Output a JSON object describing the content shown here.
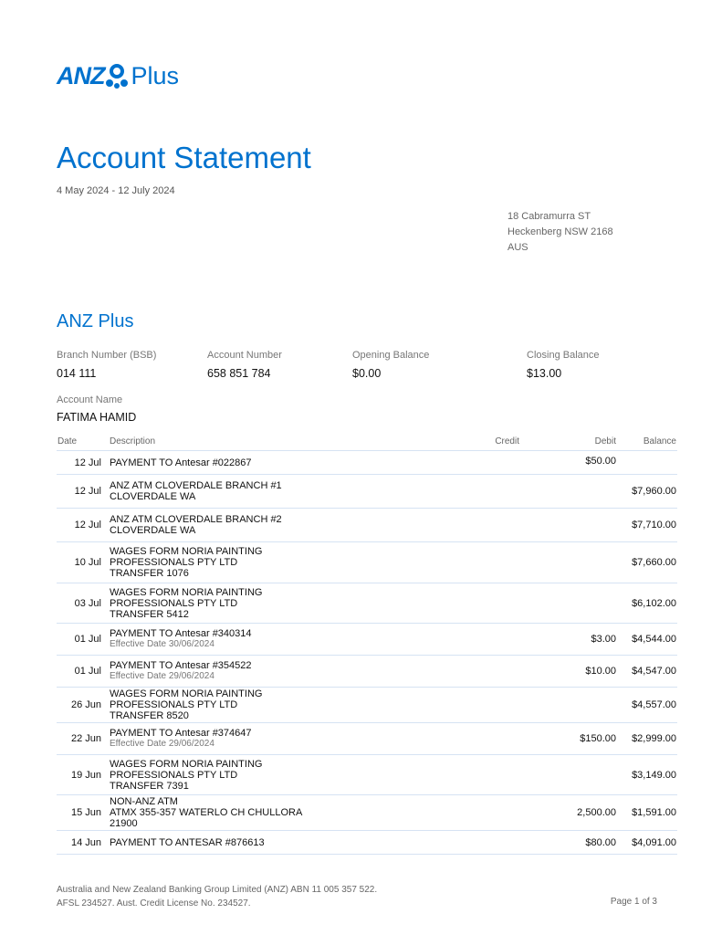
{
  "brand": {
    "logo_anz": "ANZ",
    "logo_plus": "Plus"
  },
  "title": "Account Statement",
  "period": "4 May 2024 - 12 July 2024",
  "address": [
    "18 Cabramurra ST",
    "Heckenberg NSW 2168",
    "AUS"
  ],
  "product": "ANZ Plus",
  "details": {
    "bsb_label": "Branch Number (BSB)",
    "bsb": "014 111",
    "acct_label": "Account Number",
    "acct": "658 851 784",
    "open_label": "Opening Balance",
    "open": "$0.00",
    "close_label": "Closing Balance",
    "close": "$13.00",
    "name_label": "Account Name",
    "name": "FATIMA HAMID"
  },
  "columns": {
    "date": "Date",
    "description": "Description",
    "credit": "Credit",
    "debit": "Debit",
    "balance": "Balance"
  },
  "transactions": [
    {
      "date": "12 Jul",
      "desc": [
        "PAYMENT TO Antesar #022867"
      ],
      "sub": "",
      "credit": "",
      "debit": "$50.00",
      "balance": ""
    },
    {
      "date": "12 Jul",
      "desc": [
        "ANZ ATM CLOVERDALE BRANCH #1",
        "CLOVERDALE WA"
      ],
      "sub": "",
      "credit": "",
      "debit": "",
      "balance": "$7,960.00"
    },
    {
      "date": "12 Jul",
      "desc": [
        "ANZ ATM CLOVERDALE BRANCH #2",
        "CLOVERDALE WA"
      ],
      "sub": "",
      "credit": "",
      "debit": "",
      "balance": "$7,710.00"
    },
    {
      "date": "10 Jul",
      "desc": [
        "WAGES FORM NORIA PAINTING",
        "PROFESSIONALS PTY LTD",
        "TRANSFER 1076"
      ],
      "sub": "",
      "credit": "",
      "debit": "",
      "balance": "$7,660.00"
    },
    {
      "date": "03 Jul",
      "desc": [
        "WAGES FORM NORIA PAINTING",
        "PROFESSIONALS PTY LTD",
        "TRANSFER 5412"
      ],
      "sub": "",
      "credit": "",
      "debit": "",
      "balance": "$6,102.00"
    },
    {
      "date": "01 Jul",
      "desc": [
        "PAYMENT TO Antesar #340314"
      ],
      "sub": "Effective Date 30/06/2024",
      "credit": "",
      "debit": "$3.00",
      "balance": "$4,544.00"
    },
    {
      "date": "01 Jul",
      "desc": [
        "PAYMENT TO Antesar #354522"
      ],
      "sub": "Effective Date 29/06/2024",
      "credit": "",
      "debit": "$10.00",
      "balance": "$4,547.00"
    },
    {
      "date": "26 Jun",
      "desc": [
        "WAGES FORM NORIA PAINTING",
        "PROFESSIONALS PTY LTD",
        "TRANSFER 8520"
      ],
      "sub": "",
      "credit": "",
      "debit": "",
      "balance": "$4,557.00"
    },
    {
      "date": "22 Jun",
      "desc": [
        "PAYMENT TO Antesar #374647"
      ],
      "sub": "Effective Date 29/06/2024",
      "credit": "",
      "debit": "$150.00",
      "balance": "$2,999.00"
    },
    {
      "date": "19 Jun",
      "desc": [
        "WAGES FORM NORIA PAINTING",
        "PROFESSIONALS PTY LTD",
        "TRANSFER 7391"
      ],
      "sub": "",
      "credit": "",
      "debit": "",
      "balance": "$3,149.00"
    },
    {
      "date": "15 Jun",
      "desc": [
        "NON-ANZ ATM",
        "ATMX 355-357 WATERLO CH CHULLORA",
        "21900"
      ],
      "sub": "",
      "credit": "",
      "debit": "2,500.00",
      "balance": "$1,591.00"
    },
    {
      "date": "14 Jun",
      "desc": [
        "PAYMENT TO ANTESAR #876613"
      ],
      "sub": "",
      "credit": "",
      "debit": "$80.00",
      "balance": "$4,091.00"
    }
  ],
  "footer": {
    "line1": "Australia and New Zealand Banking Group Limited (ANZ) ABN 11 005 357 522.",
    "line2": "AFSL 234527. Aust. Credit License No. 234527.",
    "page": "Page 1 of 3"
  }
}
